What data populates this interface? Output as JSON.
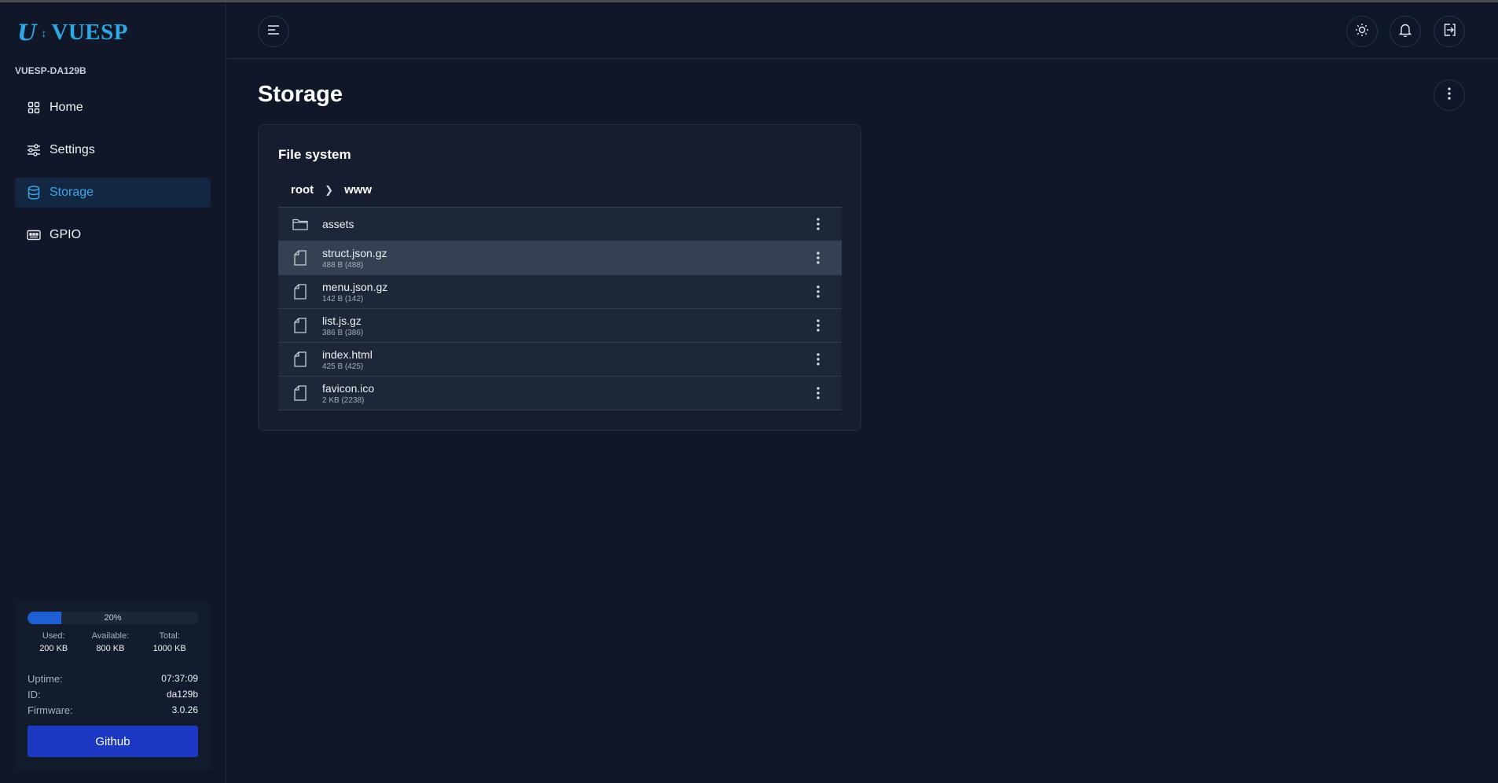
{
  "brand": {
    "logo_mark": "U",
    "logo_text": "VUESP",
    "accent_color": "#2ea8e0"
  },
  "sidebar": {
    "device_name": "VUESP-DA129B",
    "items": [
      {
        "label": "Home",
        "icon": "grid-icon",
        "active": false
      },
      {
        "label": "Settings",
        "icon": "sliders-icon",
        "active": false
      },
      {
        "label": "Storage",
        "icon": "database-icon",
        "active": true
      },
      {
        "label": "GPIO",
        "icon": "chip-icon",
        "active": false
      }
    ],
    "stats": {
      "used_fraction": 0.2,
      "percent_label": "20%",
      "used_label": "Used:",
      "used_value": "200 KB",
      "available_label": "Available:",
      "available_value": "800 KB",
      "total_label": "Total:",
      "total_value": "1000 KB",
      "uptime_label": "Uptime:",
      "uptime_value": "07:37:09",
      "id_label": "ID:",
      "id_value": "da129b",
      "firmware_label": "Firmware:",
      "firmware_value": "3.0.26",
      "github_label": "Github"
    }
  },
  "header": {
    "menu_icon": "menu-icon",
    "theme_icon": "sun-icon",
    "notifications_icon": "bell-icon",
    "logout_icon": "logout-icon"
  },
  "main": {
    "title": "Storage",
    "card": {
      "title": "File system",
      "breadcrumb": [
        "root",
        "www"
      ],
      "files": [
        {
          "name": "assets",
          "size": "",
          "type": "folder"
        },
        {
          "name": "struct.json.gz",
          "size": "488 B (488)",
          "type": "file"
        },
        {
          "name": "menu.json.gz",
          "size": "142 B (142)",
          "type": "file"
        },
        {
          "name": "list.js.gz",
          "size": "386 B (386)",
          "type": "file"
        },
        {
          "name": "index.html",
          "size": "425 B (425)",
          "type": "file"
        },
        {
          "name": "favicon.ico",
          "size": "2 KB (2238)",
          "type": "file"
        }
      ]
    }
  }
}
